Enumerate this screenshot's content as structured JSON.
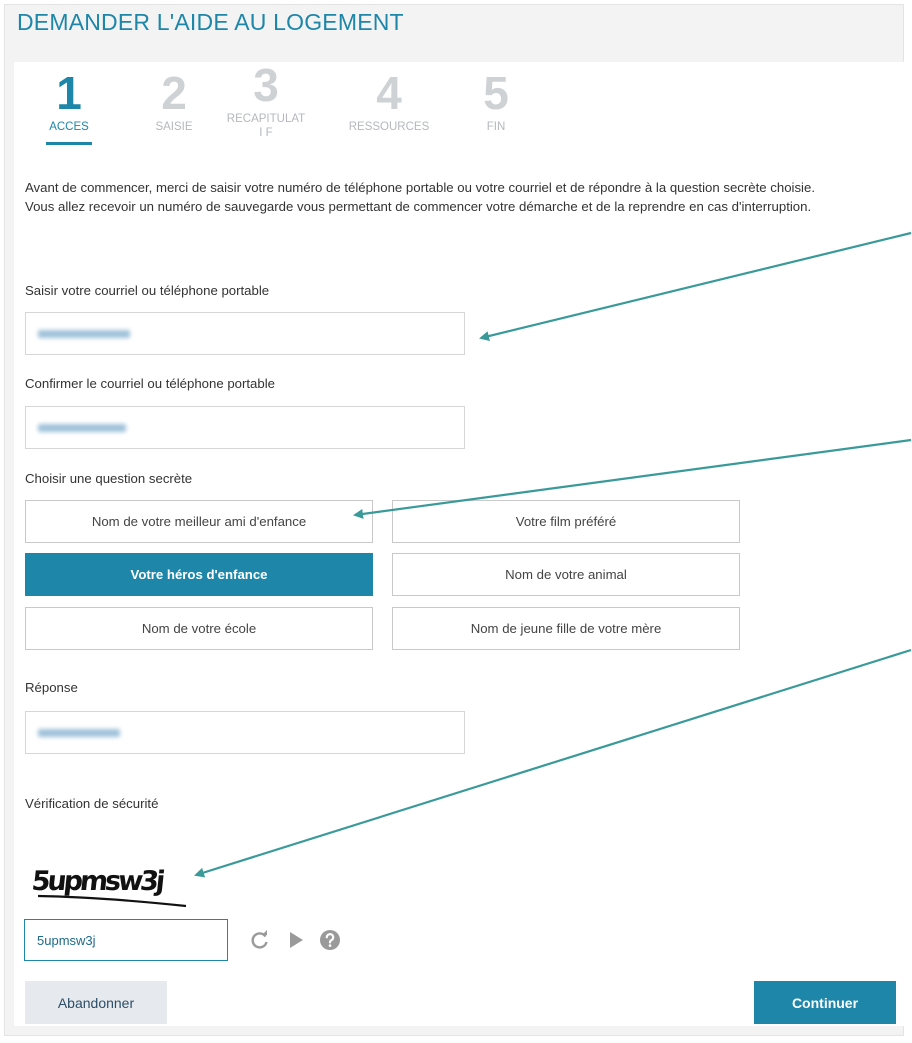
{
  "page": {
    "title": "DEMANDER L'AIDE AU LOGEMENT"
  },
  "steps": [
    {
      "number": "1",
      "label": "ACCES",
      "active": true
    },
    {
      "number": "2",
      "label": "SAISIE",
      "active": false
    },
    {
      "number": "3",
      "label": "RECAPITULATI F",
      "active": false
    },
    {
      "number": "4",
      "label": "RESSOURCES",
      "active": false
    },
    {
      "number": "5",
      "label": "FIN",
      "active": false
    }
  ],
  "intro": {
    "line1": "Avant de commencer, merci de saisir votre numéro de téléphone portable ou votre courriel et de répondre à la question secrète choisie.",
    "line2": "Vous allez recevoir un numéro de sauvegarde vous permettant de commencer votre démarche et de la reprendre en cas d'interruption."
  },
  "contact": {
    "label": "Saisir votre courriel ou téléphone portable",
    "confirm_label": "Confirmer le courriel ou téléphone portable"
  },
  "secret_question": {
    "label": "Choisir une question secrète",
    "options": [
      "Nom de votre meilleur ami d'enfance",
      "Votre film préféré",
      "Votre héros d'enfance",
      "Nom de votre animal",
      "Nom de votre école",
      "Nom de jeune fille de votre mère"
    ],
    "selected": "Votre héros d'enfance"
  },
  "answer": {
    "label": "Réponse"
  },
  "captcha": {
    "label": "Vérification de sécurité",
    "image_text": "5upmsw3j",
    "input_value": "5upmsw3j",
    "icons": [
      "refresh-icon",
      "play-icon",
      "help-icon"
    ]
  },
  "actions": {
    "abandon": "Abandonner",
    "continue": "Continuer"
  },
  "colors": {
    "accent": "#1e86a8",
    "arrow": "#3a9a9a"
  }
}
